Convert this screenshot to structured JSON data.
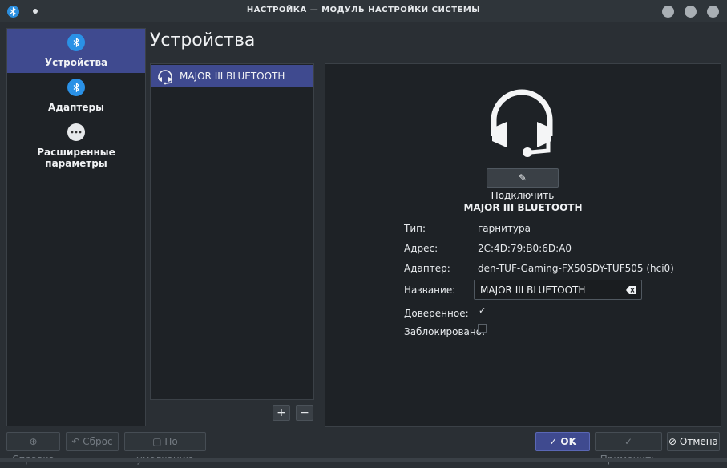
{
  "window": {
    "title": "НАСТРОЙКА — МОДУЛЬ НАСТРОЙКИ СИСТЕМЫ"
  },
  "sidebar": {
    "items": [
      {
        "label": "Устройства",
        "icon": "bluetooth-icon",
        "active": true
      },
      {
        "label": "Адаптеры",
        "icon": "bluetooth-icon",
        "active": false
      },
      {
        "label": "Расширенные параметры",
        "icon": "more-icon",
        "active": false
      }
    ]
  },
  "page": {
    "title": "Устройства"
  },
  "device_list": {
    "items": [
      {
        "label": "MAJOR III BLUETOOTH",
        "icon": "headset-icon",
        "selected": true
      }
    ],
    "add_label": "+",
    "remove_label": "−"
  },
  "detail": {
    "connect_label": "Подключить",
    "device_name": "MAJOR III BLUETOOTH",
    "type_label": "Тип:",
    "type_value": "гарнитура",
    "address_label": "Адрес:",
    "address_value": "2C:4D:79:B0:6D:A0",
    "adapter_label": "Адаптер:",
    "adapter_value": "den-TUF-Gaming-FX505DY-TUF505 (hci0)",
    "name_label": "Название:",
    "name_value": "MAJOR III BLUETOOTH",
    "trusted_label": "Доверенное:",
    "trusted_check": "✓",
    "blocked_label": "Заблокировано:"
  },
  "buttons": {
    "help": "Справка",
    "reset": "Сброс",
    "defaults": "По умолчанию",
    "ok": "OK",
    "apply": "Применить",
    "cancel": "Отмена"
  },
  "colors": {
    "accent": "#3f4a8f",
    "bluetooth": "#2a91e6",
    "background": "#2a2f34",
    "panel": "#1e2226"
  }
}
